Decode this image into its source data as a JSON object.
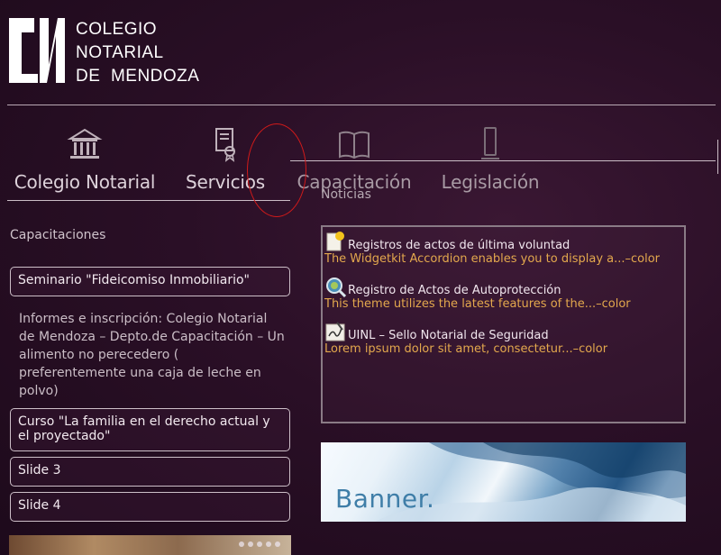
{
  "brand": {
    "lines": [
      "COLEGIO",
      "NOTARIAL",
      "DE  MENDOZA"
    ]
  },
  "nav": {
    "items": [
      {
        "label": "Colegio Notarial",
        "icon": "institution-icon"
      },
      {
        "label": "Servicios",
        "icon": "certificate-icon"
      },
      {
        "label": "Capacitación",
        "icon": "book-icon"
      },
      {
        "label": "Legislación",
        "icon": "gavel-icon"
      }
    ]
  },
  "capacitaciones": {
    "title": "Capacitaciones",
    "items": [
      {
        "label": "Seminario \"Fideicomiso Inmobiliario\""
      },
      {
        "label": "Curso \"La familia en el derecho actual y el proyectado\""
      },
      {
        "label": "Slide 3"
      },
      {
        "label": "Slide 4"
      }
    ],
    "open_body": "Informes e inscripción: Colegio Notarial de Mendoza – Depto.de Capacitación – Un alimento no perecedero ( preferentemente una caja de leche en polvo)"
  },
  "noticias": {
    "title": "Noticias",
    "items": [
      {
        "title": "Registros de actos de última voluntad",
        "snippet": "The Widgetkit Accordion enables you to display a...–color",
        "icon": "document-star-icon"
      },
      {
        "title": "Registro de Actos de Autoprotección",
        "snippet": "This theme utilizes the latest features of the...–color",
        "icon": "magnifier-icon"
      },
      {
        "title": "UINL – Sello Notarial de Seguridad",
        "snippet": "Lorem ipsum dolor sit amet, consectetur...–color",
        "icon": "signature-icon"
      }
    ]
  },
  "banner": {
    "text": "Banner."
  },
  "colors": {
    "accent_red": "#d11a1a",
    "snippet_orange": "#e3a84d"
  }
}
